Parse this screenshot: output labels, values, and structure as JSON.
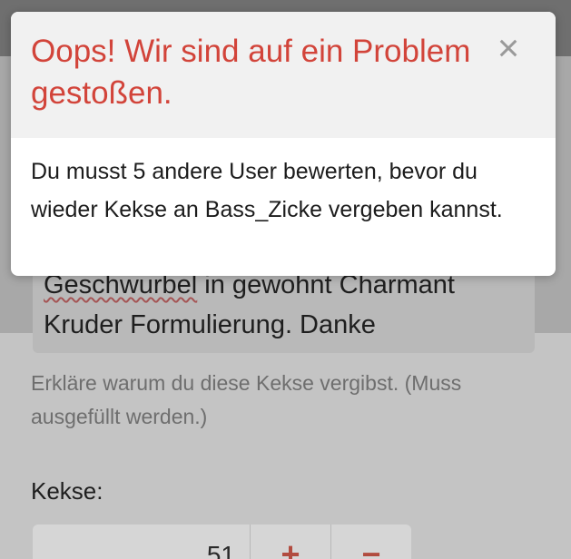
{
  "modal": {
    "title": "Oops! Wir sind auf ein Problem gestoßen.",
    "close_glyph": "×",
    "message": "Du musst 5 andere User bewerten, bevor du wieder Kekse an Bass_Zicke vergeben kannst."
  },
  "form": {
    "reason_text_underlined": "Geschwurbel",
    "reason_text_rest_line1": " in gewohnt Charmant",
    "reason_text_line2": "Kruder Formulierung. Danke",
    "help_text": "Erkläre warum du diese Kekse vergibst. (Muss ausgefüllt werden.)",
    "kekse_label": "Kekse:",
    "kekse_value": "51",
    "increment_label": "+",
    "decrement_label": "−"
  },
  "colors": {
    "title_red": "#d2443a",
    "accent_red": "#b24b3f"
  }
}
